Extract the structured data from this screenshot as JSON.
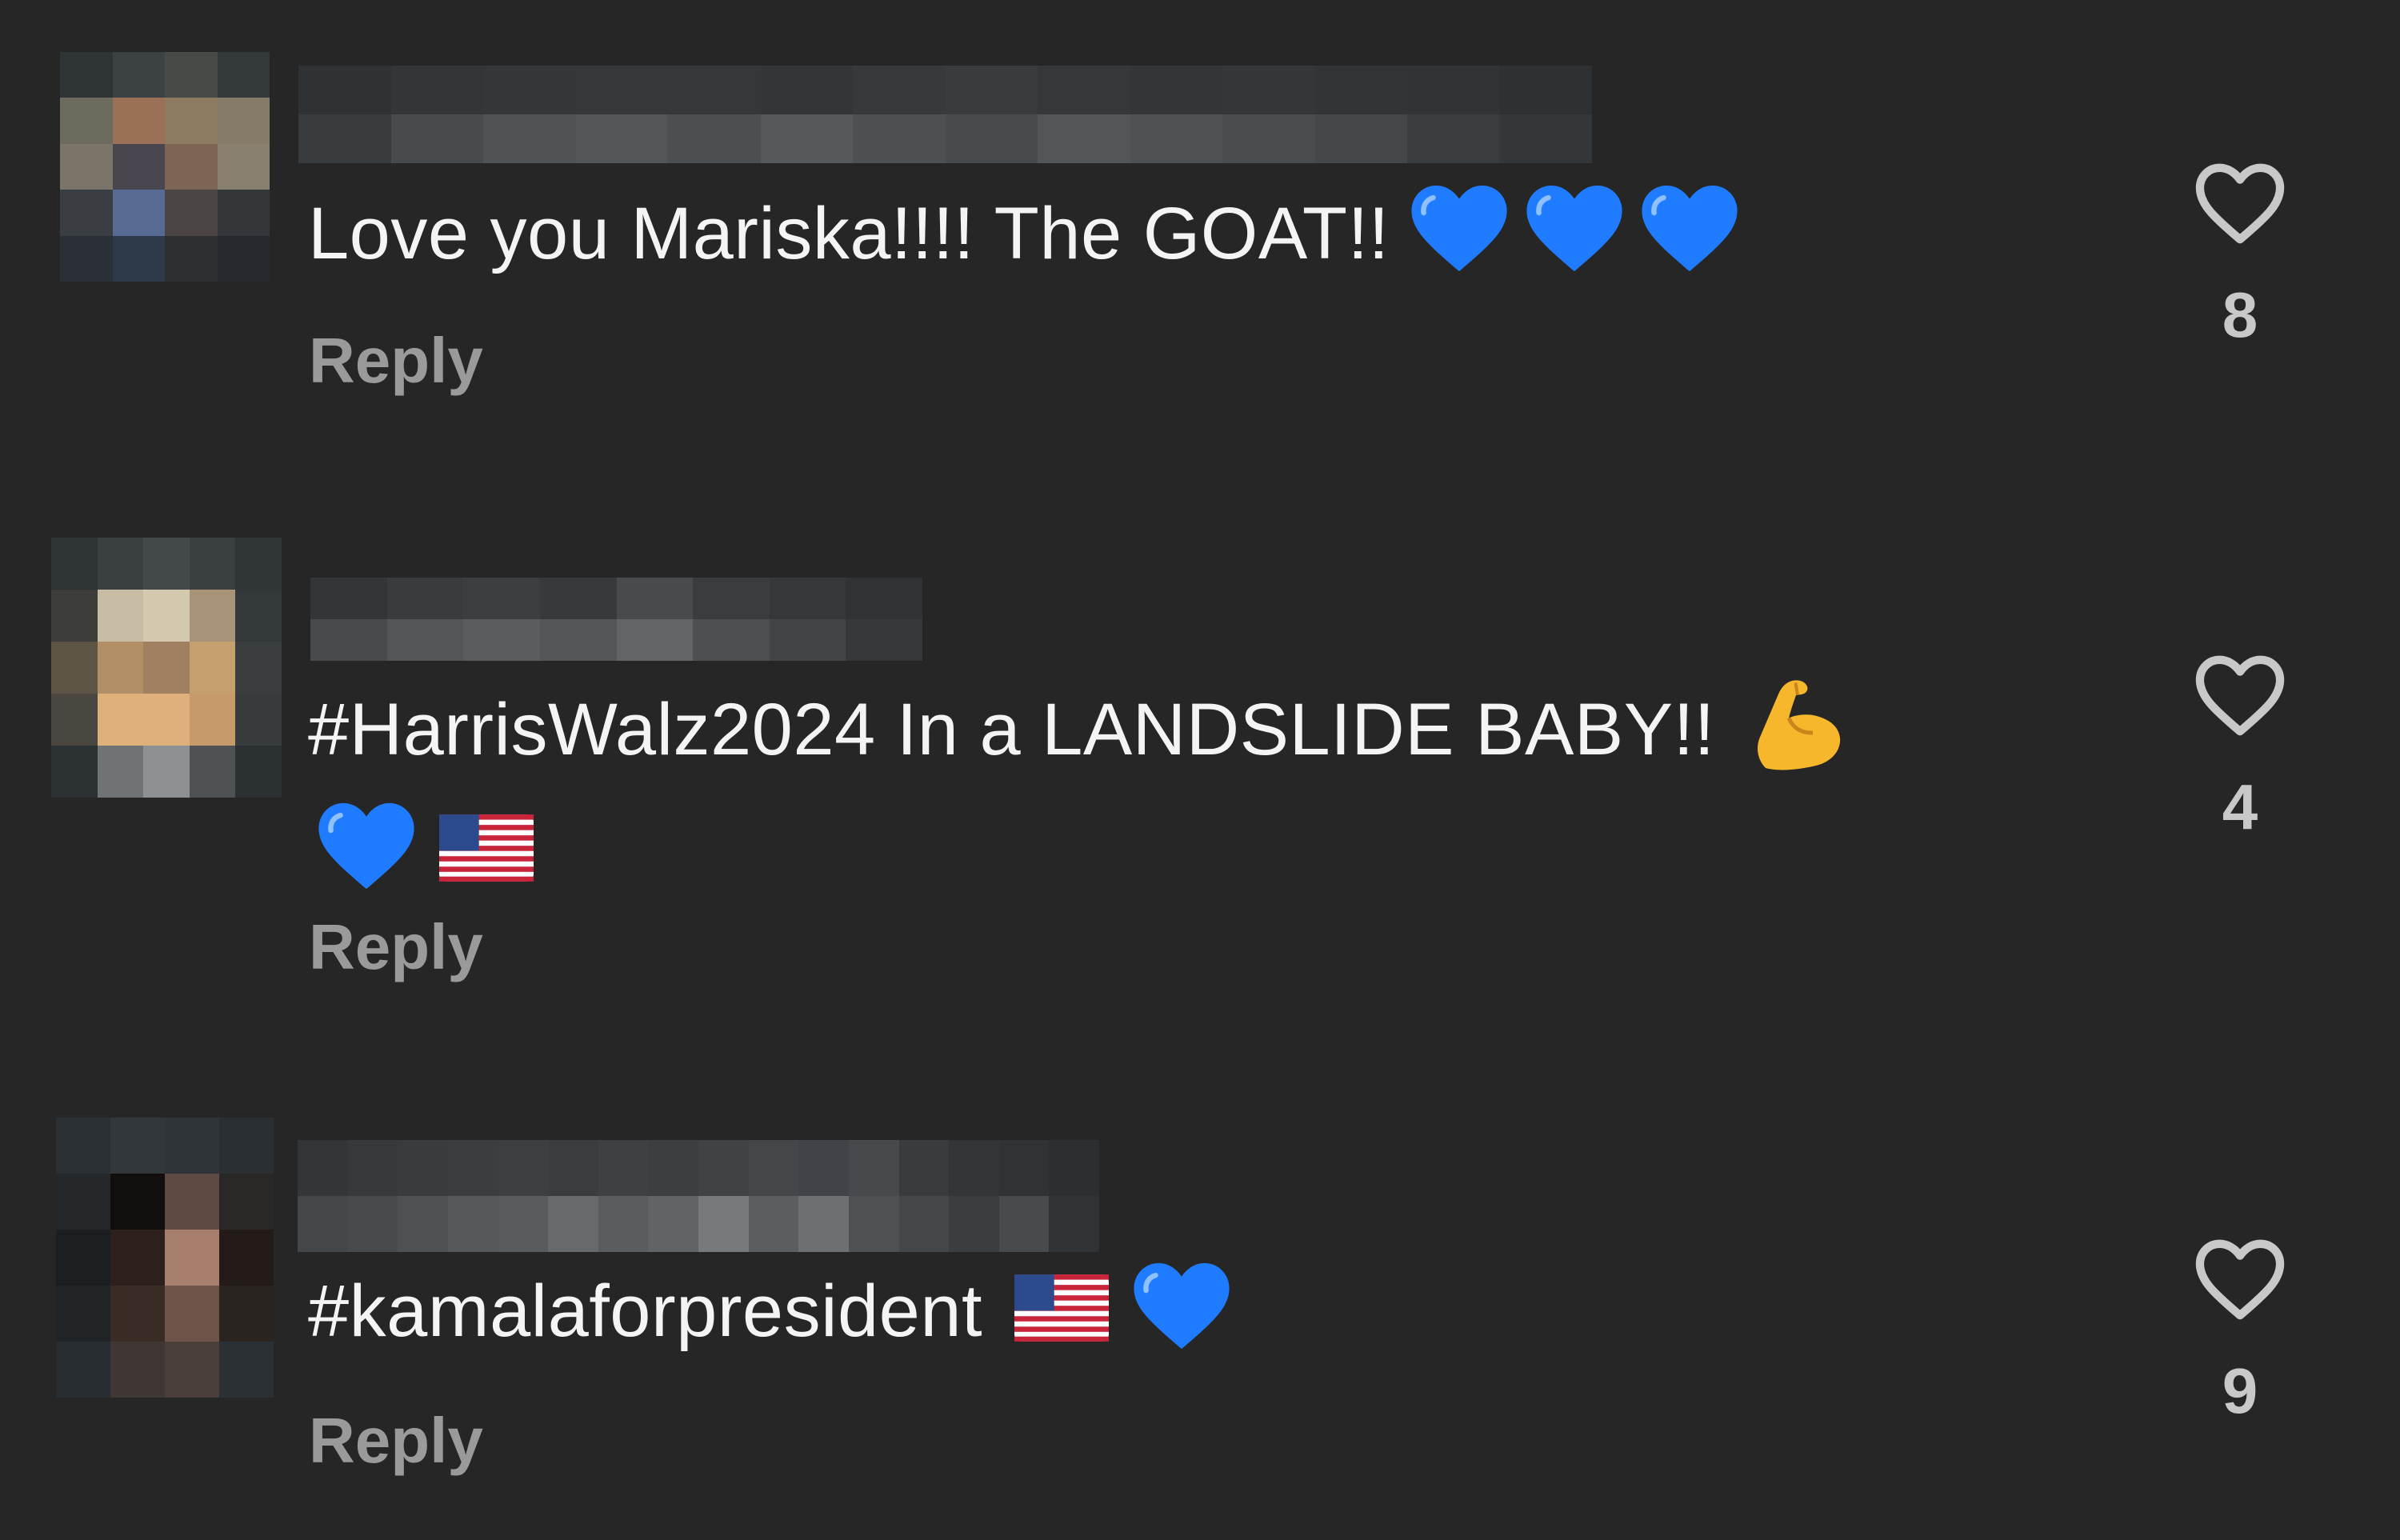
{
  "comments": [
    {
      "text": "Love you Mariska!!!! The GOAT!!",
      "text_line2": "",
      "emojis": [
        "blue-heart",
        "blue-heart",
        "blue-heart"
      ],
      "reply_label": "Reply",
      "likes": "8"
    },
    {
      "text": "#HarrisWalz2024 In a LANDSLIDE BABY!!",
      "text_line2": "",
      "emojis": [
        "flexed-biceps"
      ],
      "emojis_line2": [
        "blue-heart",
        "us-flag"
      ],
      "reply_label": "Reply",
      "likes": "4"
    },
    {
      "text": "#kamalaforpresident",
      "text_line2": "",
      "emojis": [
        "us-flag",
        "blue-heart"
      ],
      "reply_label": "Reply",
      "likes": "9"
    }
  ],
  "colors": {
    "background": "#262626",
    "text": "#f4f4f4",
    "reply": "#9a9a9a",
    "heart_outline": "#c8c8c8",
    "blue_heart": "#1f7bff"
  }
}
